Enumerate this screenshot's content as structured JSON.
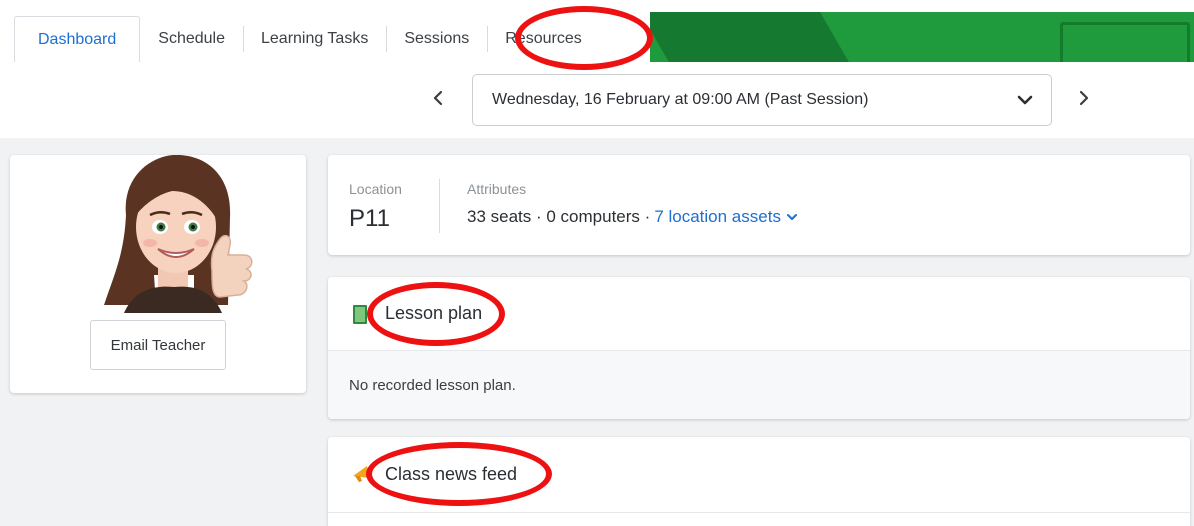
{
  "tabs": [
    {
      "label": "Dashboard",
      "active": true
    },
    {
      "label": "Schedule",
      "active": false
    },
    {
      "label": "Learning Tasks",
      "active": false
    },
    {
      "label": "Sessions",
      "active": false
    },
    {
      "label": "Resources",
      "active": false
    }
  ],
  "session": {
    "prev_icon": "chevron-left-icon",
    "next_icon": "chevron-right-icon",
    "selected": "Wednesday, 16 February at 09:00 AM (Past Session)"
  },
  "teacher": {
    "email_button": "Email Teacher"
  },
  "location": {
    "label": "Location",
    "value": "P11",
    "attributes_label": "Attributes",
    "attributes_text": "33 seats · 0 computers ·",
    "assets_link": "7 location assets"
  },
  "lesson_plan": {
    "title": "Lesson plan",
    "empty_text": "No recorded lesson plan."
  },
  "news_feed": {
    "title": "Class news feed"
  },
  "colors": {
    "accent": "#1d6fd1",
    "banner_green": "#1f9a3d",
    "annotation_red": "#ee1111",
    "background": "#f1f2f4"
  }
}
